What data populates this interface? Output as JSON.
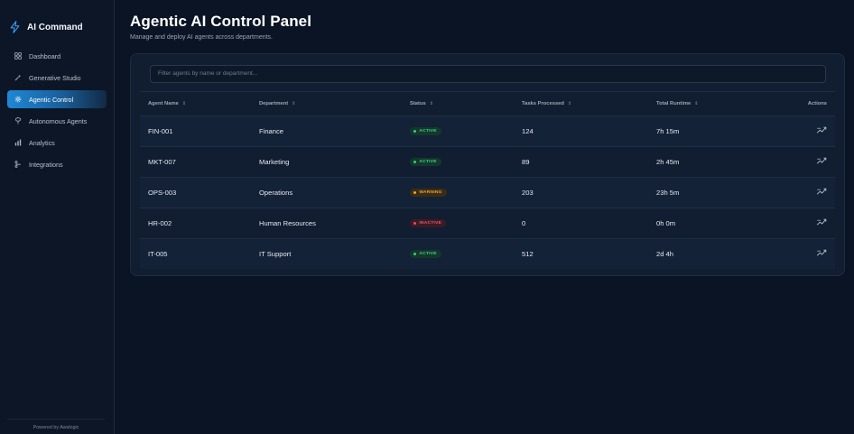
{
  "sidebar": {
    "brand": "AI Command",
    "items": [
      {
        "label": "Dashboard",
        "icon": "grid-icon"
      },
      {
        "label": "Generative Studio",
        "icon": "sparkle-icon"
      },
      {
        "label": "Agentic Control",
        "icon": "gear-icon",
        "active": true
      },
      {
        "label": "Autonomous Agents",
        "icon": "brain-icon"
      },
      {
        "label": "Analytics",
        "icon": "bar-chart-icon"
      },
      {
        "label": "Integrations",
        "icon": "branch-icon"
      }
    ],
    "footer": "Powered by Awslogic"
  },
  "header": {
    "title": "Agentic AI Control Panel",
    "subtitle": "Manage and deploy AI agents across departments."
  },
  "filter": {
    "placeholder": "Filter agents by name or department...",
    "value": ""
  },
  "table": {
    "columns": {
      "name": "Agent Name",
      "department": "Department",
      "status": "Status",
      "tasks": "Tasks Processed",
      "runtime": "Total Runtime",
      "actions": "Actions"
    },
    "rows": [
      {
        "name": "FIN-001",
        "department": "Finance",
        "status": "ACTIVE",
        "tasks": "124",
        "runtime": "7h 15m"
      },
      {
        "name": "MKT-007",
        "department": "Marketing",
        "status": "ACTIVE",
        "tasks": "89",
        "runtime": "2h 45m"
      },
      {
        "name": "OPS-003",
        "department": "Operations",
        "status": "WARNING",
        "tasks": "203",
        "runtime": "23h 5m"
      },
      {
        "name": "HR-002",
        "department": "Human Resources",
        "status": "INACTIVE",
        "tasks": "0",
        "runtime": "0h 0m"
      },
      {
        "name": "IT-005",
        "department": "IT Support",
        "status": "ACTIVE",
        "tasks": "512",
        "runtime": "2d 4h"
      }
    ]
  },
  "colors": {
    "background": "#0b1424",
    "panel": "#111e31",
    "accent": "#1e88d6",
    "active": "#30d07e",
    "warning": "#f5a623",
    "inactive": "#ef4a5f"
  }
}
